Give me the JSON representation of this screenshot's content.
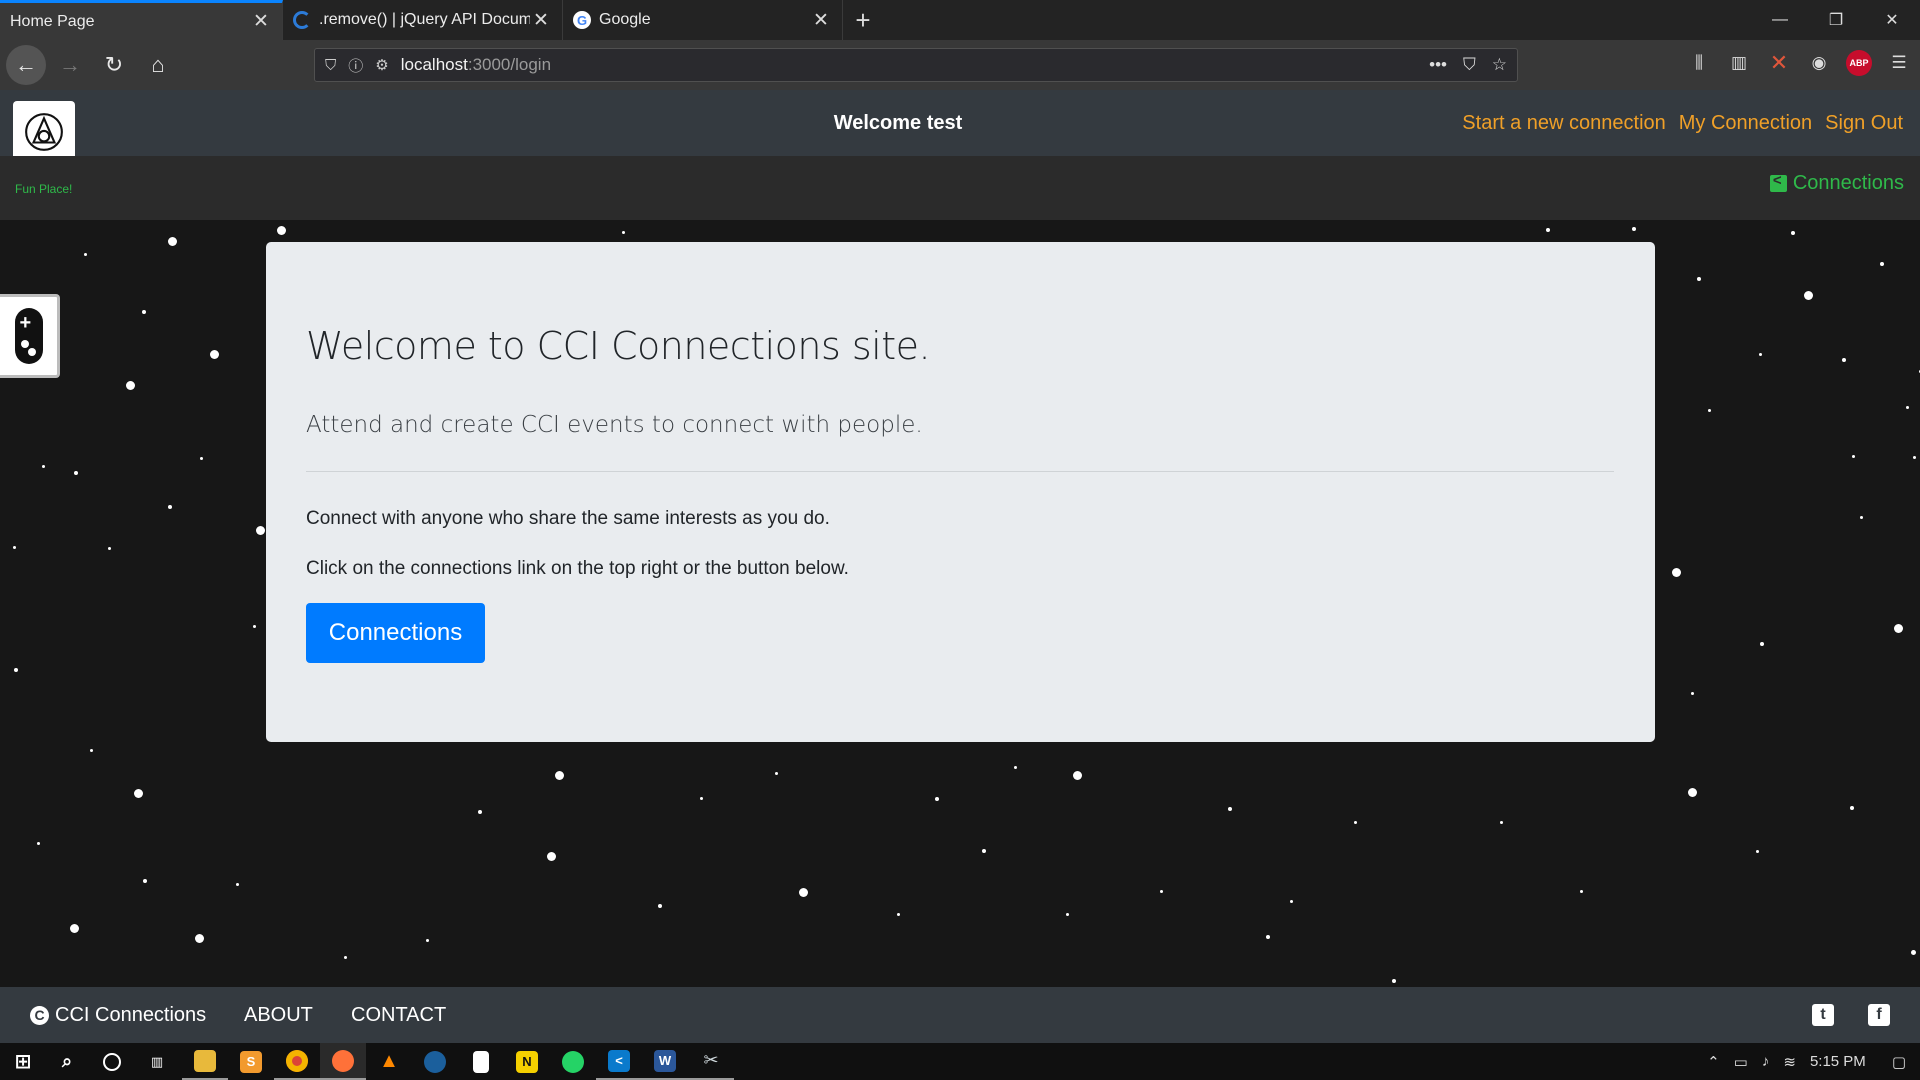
{
  "browser": {
    "tabs": [
      {
        "title": "Home Page",
        "active": true
      },
      {
        "title": ".remove() | jQuery API Docume",
        "active": false
      },
      {
        "title": "Google",
        "active": false
      }
    ],
    "new_tab_label": "+",
    "url_host": "localhost",
    "url_path": ":3000/login"
  },
  "site": {
    "welcome": "Welcome test",
    "nav_links": [
      "Start a new connection",
      "My Connection",
      "Sign Out"
    ],
    "tagline": "Fun Place!",
    "sub_link": "Connections"
  },
  "jumbotron": {
    "title": "Welcome to CCI Connections site.",
    "lead": "Attend and create CCI events to connect with people.",
    "p1": "Connect with anyone who share the same interests as you do.",
    "p2": "Click on the connections link on the top right or the button below.",
    "button": "Connections"
  },
  "footer": {
    "brand": "CCI Connections",
    "links": [
      "ABOUT",
      "CONTACT"
    ],
    "social": [
      "twitter-icon",
      "facebook-icon"
    ]
  },
  "taskbar": {
    "time": "5:15 PM",
    "apps": [
      "windows-start-icon",
      "search-icon",
      "cortana-icon",
      "task-view-icon",
      "file-explorer-icon",
      "sublime-text-icon",
      "chrome-icon",
      "firefox-icon",
      "vlc-icon",
      "steam-icon",
      "notepad-icon",
      "norton-icon",
      "whatsapp-icon",
      "vscode-icon",
      "word-icon",
      "snipping-tool-icon"
    ]
  },
  "colors": {
    "accent_orange": "#f0a028",
    "accent_green": "#2fb94a",
    "primary_blue": "#007bff",
    "header_bg": "#343a40",
    "page_bg": "#171717",
    "card_bg": "#e9ecef"
  }
}
